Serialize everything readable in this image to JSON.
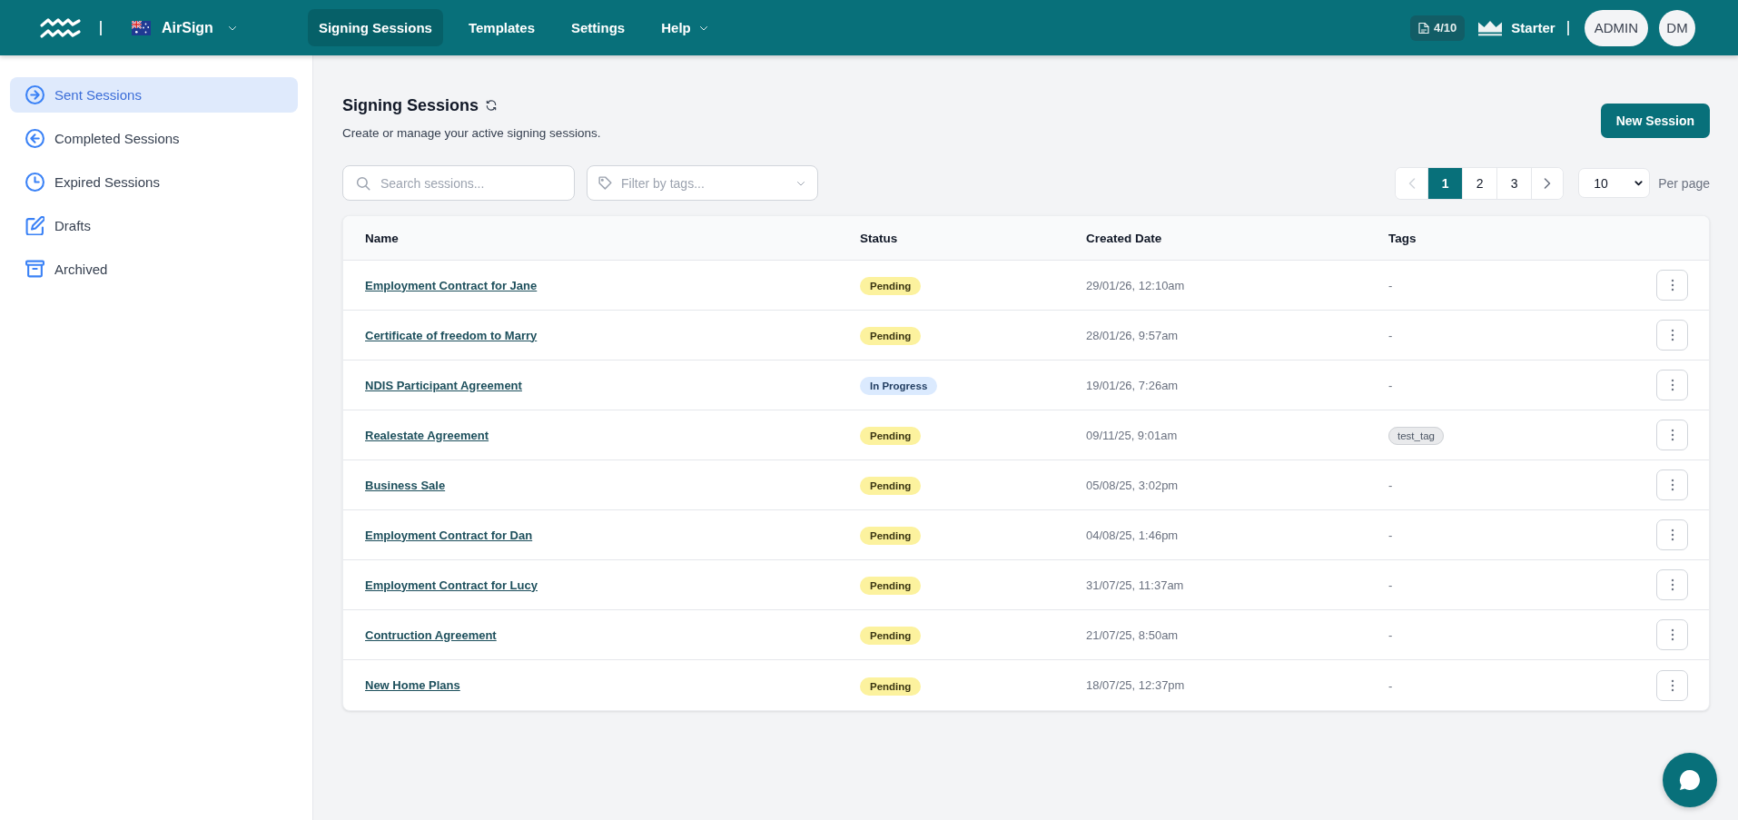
{
  "top_bar": {
    "brand": "AirSign",
    "nav": [
      {
        "label": "Signing Sessions",
        "selected": true,
        "has_menu": false
      },
      {
        "label": "Templates",
        "selected": false,
        "has_menu": false
      },
      {
        "label": "Settings",
        "selected": false,
        "has_menu": false
      },
      {
        "label": "Help",
        "selected": false,
        "has_menu": true
      }
    ],
    "usage": "4/10",
    "plan": "Starter",
    "role": "ADMIN",
    "avatar": "DM"
  },
  "sidebar": {
    "items": [
      {
        "label": "Sent Sessions",
        "kind": "sent",
        "selected": true
      },
      {
        "label": "Completed Sessions",
        "kind": "completed",
        "selected": false
      },
      {
        "label": "Expired Sessions",
        "kind": "expired",
        "selected": false
      },
      {
        "label": "Drafts",
        "kind": "drafts",
        "selected": false
      },
      {
        "label": "Archived",
        "kind": "archived",
        "selected": false
      }
    ]
  },
  "header": {
    "title": "Signing Sessions",
    "subtitle": "Create or manage your active signing sessions.",
    "new_button": "New Session"
  },
  "filters": {
    "search": {
      "placeholder": "Search sessions..."
    },
    "tags": {
      "placeholder": "Filter by tags..."
    }
  },
  "pagination": {
    "prev_disabled": true,
    "next_disabled": false,
    "pages": [
      {
        "label": "1",
        "selected": true
      },
      {
        "label": "2",
        "selected": false
      },
      {
        "label": "3",
        "selected": false
      }
    ],
    "per_page": {
      "value": "10",
      "label": "Per page"
    }
  },
  "table": {
    "columns": [
      "Name",
      "Status",
      "Created Date",
      "Tags"
    ],
    "rows": [
      {
        "name": "Employment Contract for Jane",
        "status": {
          "label": "Pending",
          "kind": "pending"
        },
        "created": "29/01/26, 12:10am",
        "tags": {
          "kind": "none",
          "text": "-"
        }
      },
      {
        "name": "Certificate of freedom to Marry",
        "status": {
          "label": "Pending",
          "kind": "pending"
        },
        "created": "28/01/26, 9:57am",
        "tags": {
          "kind": "none",
          "text": "-"
        }
      },
      {
        "name": "NDIS Participant Agreement",
        "status": {
          "label": "In Progress",
          "kind": "in_progress"
        },
        "created": "19/01/26, 7:26am",
        "tags": {
          "kind": "none",
          "text": "-"
        }
      },
      {
        "name": "Realestate Agreement",
        "status": {
          "label": "Pending",
          "kind": "pending"
        },
        "created": "09/11/25, 9:01am",
        "tags": {
          "kind": "chip",
          "text": "test_tag"
        }
      },
      {
        "name": "Business Sale",
        "status": {
          "label": "Pending",
          "kind": "pending"
        },
        "created": "05/08/25, 3:02pm",
        "tags": {
          "kind": "none",
          "text": "-"
        }
      },
      {
        "name": "Employment Contract for Dan",
        "status": {
          "label": "Pending",
          "kind": "pending"
        },
        "created": "04/08/25, 1:46pm",
        "tags": {
          "kind": "none",
          "text": "-"
        }
      },
      {
        "name": "Employment Contract for Lucy",
        "status": {
          "label": "Pending",
          "kind": "pending"
        },
        "created": "31/07/25, 11:37am",
        "tags": {
          "kind": "none",
          "text": "-"
        }
      },
      {
        "name": "Contruction Agreement",
        "status": {
          "label": "Pending",
          "kind": "pending"
        },
        "created": "21/07/25, 8:50am",
        "tags": {
          "kind": "none",
          "text": "-"
        }
      },
      {
        "name": "New Home Plans",
        "status": {
          "label": "Pending",
          "kind": "pending"
        },
        "created": "18/07/25, 12:37pm",
        "tags": {
          "kind": "none",
          "text": "-"
        }
      }
    ]
  }
}
